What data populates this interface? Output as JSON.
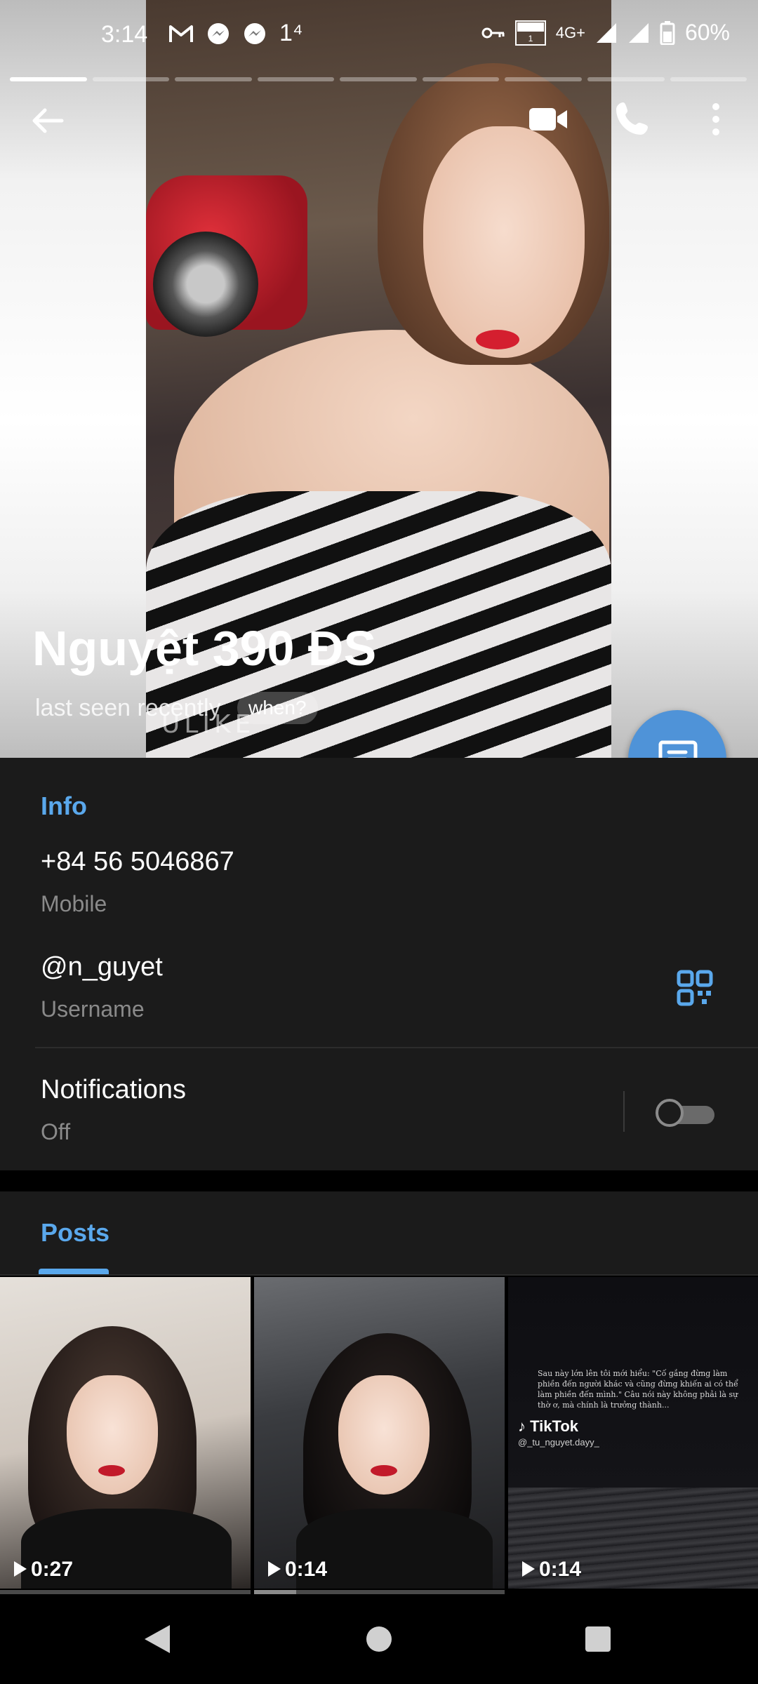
{
  "status_bar": {
    "time": "3:14",
    "notif_count": "1⁴",
    "volte": "VoLTE",
    "network": "4G+",
    "battery": "60%"
  },
  "story_progress": {
    "total_segments": 9,
    "active_index": 0
  },
  "header": {
    "name": "Nguyệt 390 ĐS",
    "last_seen": "last seen recently",
    "when_label": "when?",
    "photo_watermark": "ULIKE"
  },
  "info": {
    "section_title": "Info",
    "phone": {
      "value": "+84 56 5046867",
      "label": "Mobile"
    },
    "username": {
      "value": "@n_guyet",
      "label": "Username"
    },
    "notifications": {
      "value": "Notifications",
      "state": "Off",
      "enabled": false
    }
  },
  "posts": {
    "tab_label": "Posts",
    "items": [
      {
        "duration": "0:27"
      },
      {
        "duration": "0:14"
      },
      {
        "duration": "0:14",
        "overlay_text": "Sau này lớn lên tôi mới hiểu: \"Cố gắng đừng làm phiền đến người khác và cũng đừng khiến ai có thể làm phiền đến mình.\" Câu nói này không phải là sự thờ ơ, mà chính là trưởng thành...",
        "brand": "TikTok",
        "handle": "@_tu_nguyet.dayy_"
      }
    ]
  },
  "colors": {
    "accent": "#5aa8ec",
    "fab": "#4f93d8",
    "panel": "#1b1b1b"
  }
}
